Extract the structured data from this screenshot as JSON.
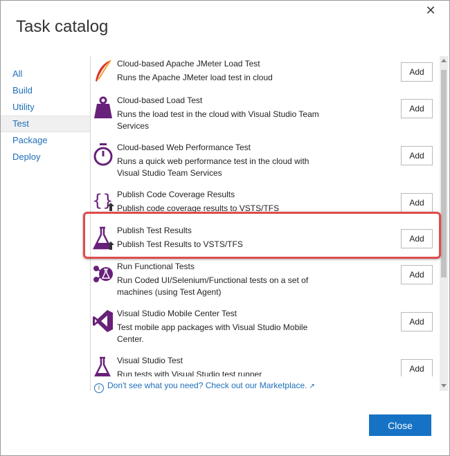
{
  "dialog": {
    "title": "Task catalog",
    "close_icon": "close-icon"
  },
  "sidebar": {
    "items": [
      {
        "label": "All",
        "active": false
      },
      {
        "label": "Build",
        "active": false
      },
      {
        "label": "Utility",
        "active": false
      },
      {
        "label": "Test",
        "active": true
      },
      {
        "label": "Package",
        "active": false
      },
      {
        "label": "Deploy",
        "active": false
      }
    ]
  },
  "tasks": [
    {
      "name": "Cloud-based Apache JMeter Load Test",
      "desc": "Runs the Apache JMeter load test in cloud",
      "icon": "feather-icon",
      "add": "Add"
    },
    {
      "name": "Cloud-based Load Test",
      "desc": "Runs the load test in the cloud with Visual Studio Team Services",
      "icon": "weight-icon",
      "add": "Add"
    },
    {
      "name": "Cloud-based Web Performance Test",
      "desc": "Runs a quick web performance test in the cloud with Visual Studio Team Services",
      "icon": "stopwatch-icon",
      "add": "Add"
    },
    {
      "name": "Publish Code Coverage Results",
      "desc": "Publish code coverage results to VSTS/TFS",
      "icon": "braces-upload-icon",
      "add": "Add"
    },
    {
      "name": "Publish Test Results",
      "desc": "Publish Test Results to VSTS/TFS",
      "icon": "flask-upload-icon",
      "add": "Add"
    },
    {
      "name": "Run Functional Tests",
      "desc": "Run Coded UI/Selenium/Functional tests on a set of machines (using Test Agent)",
      "icon": "flask-network-icon",
      "add": "Add"
    },
    {
      "name": "Visual Studio Mobile Center Test",
      "desc": "Test mobile app packages with Visual Studio Mobile Center.",
      "icon": "visual-studio-icon",
      "add": "Add"
    },
    {
      "name": "Visual Studio Test",
      "desc": "Run tests with Visual Studio test runner",
      "icon": "flask-icon",
      "add": "Add"
    }
  ],
  "footer": {
    "marketplace_link": "Don't see what you need? Check out our Marketplace.",
    "close_label": "Close"
  },
  "colors": {
    "accent": "#1672c4",
    "link": "#1e6fb9",
    "icon_purple": "#68217a",
    "highlight": "#e04b4b"
  }
}
